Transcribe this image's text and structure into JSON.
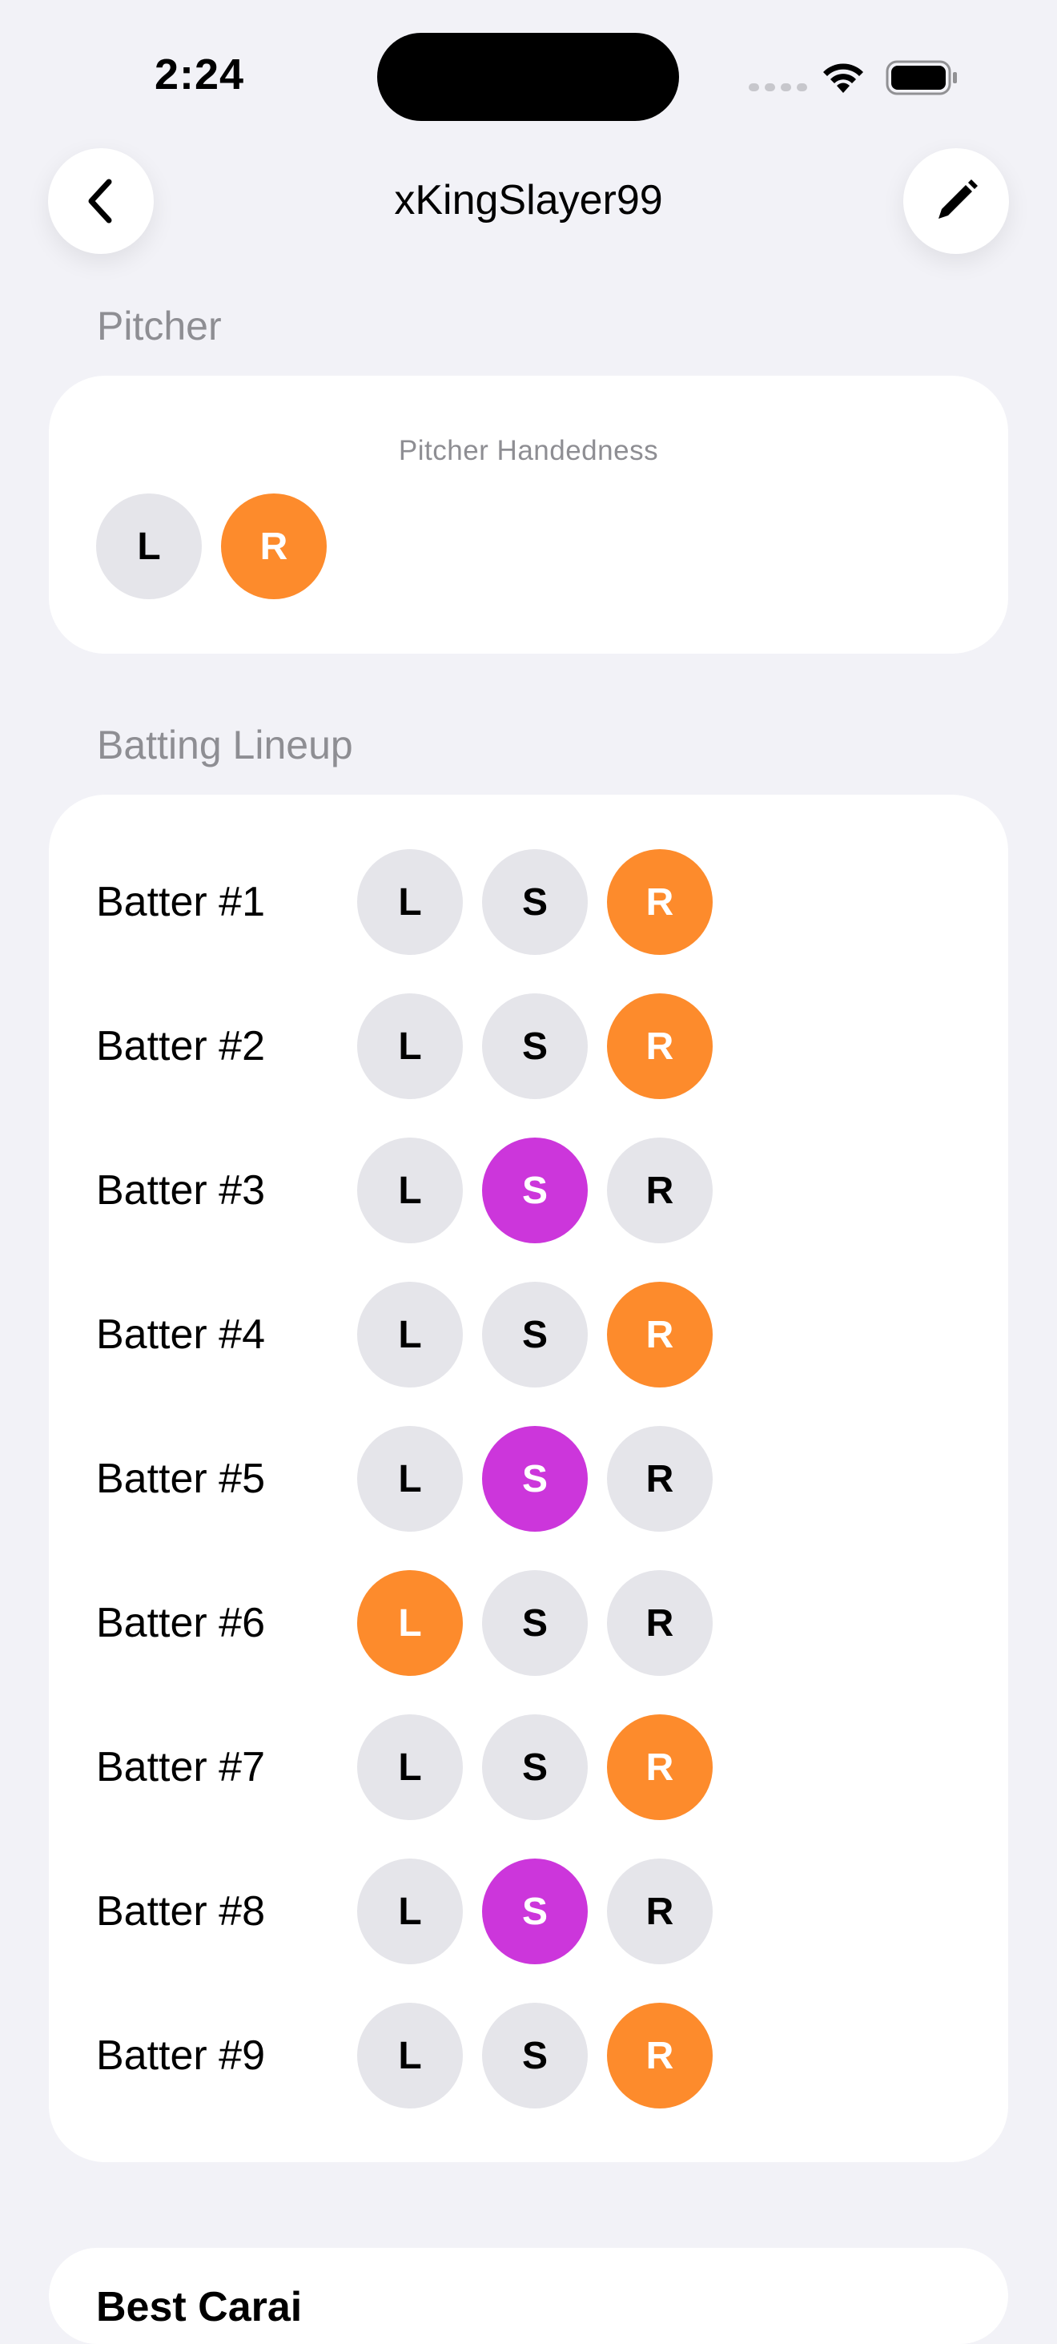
{
  "status": {
    "time": "2:24"
  },
  "nav": {
    "title": "xKingSlayer99"
  },
  "pitcher": {
    "section_title": "Pitcher",
    "caption": "Pitcher Handedness",
    "options": [
      "L",
      "R"
    ],
    "selected": "R"
  },
  "lineup": {
    "section_title": "Batting Lineup",
    "batters": [
      {
        "label": "Batter #1",
        "selected": "R"
      },
      {
        "label": "Batter #2",
        "selected": "R"
      },
      {
        "label": "Batter #3",
        "selected": "S"
      },
      {
        "label": "Batter #4",
        "selected": "R"
      },
      {
        "label": "Batter #5",
        "selected": "S"
      },
      {
        "label": "Batter #6",
        "selected": "L"
      },
      {
        "label": "Batter #7",
        "selected": "R"
      },
      {
        "label": "Batter #8",
        "selected": "S"
      },
      {
        "label": "Batter #9",
        "selected": "R"
      }
    ],
    "options": [
      "L",
      "S",
      "R"
    ]
  },
  "next_section": {
    "title": "Best Carai"
  },
  "colors": {
    "accent_orange": "#fd8b2c",
    "accent_purple": "#cc36db",
    "chip_gray": "#e5e5ea"
  },
  "icons": {
    "back": "chevron-left-icon",
    "edit": "pencil-icon"
  }
}
